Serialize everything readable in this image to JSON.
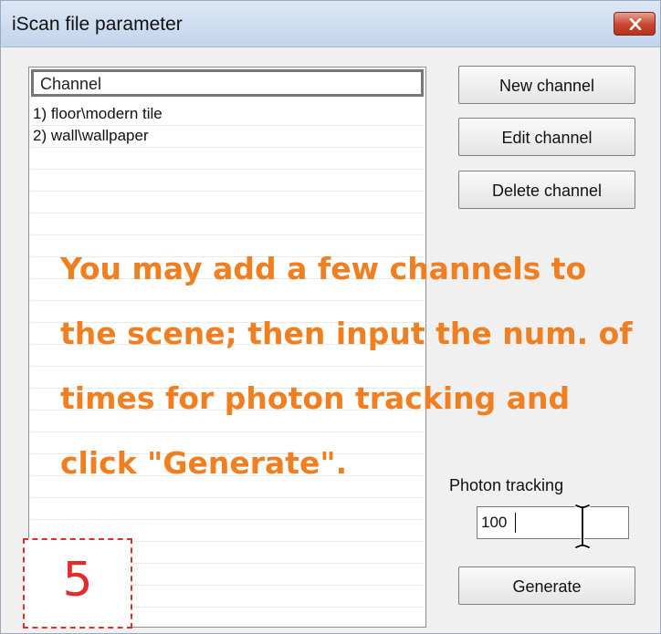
{
  "window": {
    "title": "iScan file parameter",
    "close_icon": "close-icon"
  },
  "channel_list": {
    "header": "Channel",
    "items": [
      "1)  floor\\modern tile",
      "2)  wall\\wallpaper"
    ]
  },
  "buttons": {
    "new_channel": "New channel",
    "edit_channel": "Edit channel",
    "delete_channel": "Delete channel",
    "generate": "Generate"
  },
  "annotation": {
    "lines": [
      "You may add a few channels to",
      "the scene; then input the num. of",
      "times for photon tracking and",
      "click \"Generate\"."
    ],
    "color": "#f07f22"
  },
  "photon_tracking": {
    "label": "Photon tracking",
    "value": "100"
  },
  "step_badge": {
    "number": "5",
    "color": "#e22d2d"
  }
}
